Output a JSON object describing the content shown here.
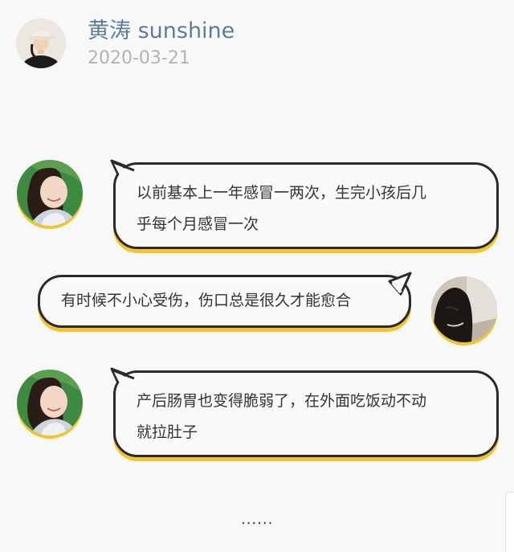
{
  "post": {
    "author": "黄涛 sunshine",
    "date": "2020-03-21",
    "author_avatar_icon": "woman-in-bucket-hat-photo"
  },
  "messages": [
    {
      "side": "left",
      "avatar_icon": "smiling-woman-avatar",
      "lines": [
        "以前基本上一年感冒一两次，生完小孩后几",
        "乎每个月感冒一次"
      ]
    },
    {
      "side": "right",
      "avatar_icon": "woman-long-hair-avatar",
      "lines": [
        "有时候不小心受伤，伤口总是很久才能愈合"
      ]
    },
    {
      "side": "left",
      "avatar_icon": "smiling-woman-avatar",
      "lines": [
        "产后肠胃也变得脆弱了，在外面吃饭动不动",
        "就拉肚子"
      ]
    }
  ],
  "footer": {
    "ellipsis": "......"
  },
  "colors": {
    "accent_shadow": "#f3c42f",
    "bubble_border": "#2b2b2b",
    "author_name": "#5e7c96",
    "date": "#b3b3b3"
  }
}
